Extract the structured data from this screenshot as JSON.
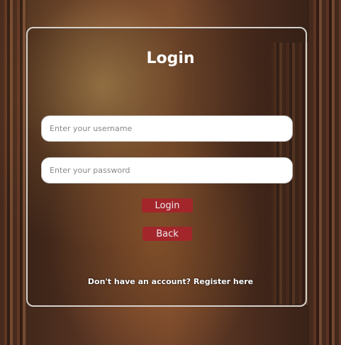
{
  "form": {
    "title": "Login",
    "username_placeholder": "Enter your username",
    "password_placeholder": "Enter your password",
    "login_label": "Login",
    "back_label": "Back",
    "register_link": "Don't have an account? Register here"
  }
}
